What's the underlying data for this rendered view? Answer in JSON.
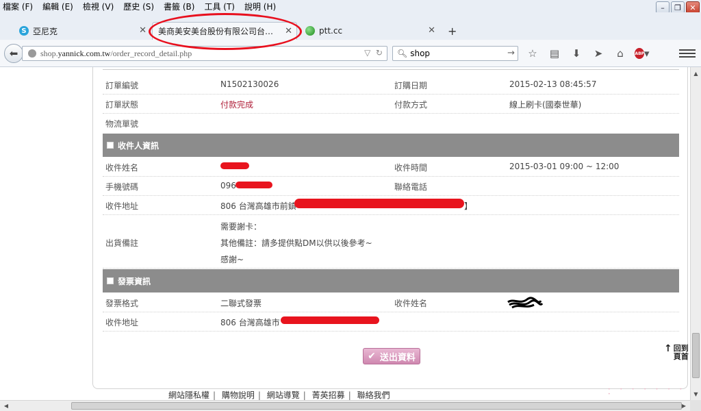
{
  "menu": [
    "檔案 (F)",
    "編輯 (E)",
    "檢視 (V)",
    "歷史 (S)",
    "書籤 (B)",
    "工具 (T)",
    "說明 (H)"
  ],
  "tabs": [
    {
      "label": "亞尼克",
      "icon_color": "#2aa4db",
      "icon": "S"
    },
    {
      "label": "美商美安美台股份有限公司台…",
      "active": true
    },
    {
      "label": "ptt.cc",
      "icon_color": "#2b9a2b"
    }
  ],
  "nav": {
    "url_prefix": "shop.",
    "url_host": "yannick.com.tw",
    "url_path": "/order_record_detail.php",
    "search_value": "shop"
  },
  "order": {
    "order_no_label": "訂單編號",
    "order_no": "N1502130026",
    "order_date_label": "訂購日期",
    "order_date": "2015-02-13 08:45:57",
    "status_label": "訂單狀態",
    "status": "付款完成",
    "payment_label": "付款方式",
    "payment": "線上刷卡(國泰世華)",
    "logistics_label": "物流單號"
  },
  "recipient": {
    "section_title": "收件人資訊",
    "name_label": "收件姓名",
    "time_label": "收件時間",
    "time": "2015-03-01 09:00 ~ 12:00",
    "mobile_label": "手機號碼",
    "mobile_prefix": "096",
    "phone_label": "聯絡電話",
    "address_label": "收件地址",
    "address_prefix": "806 台灣高雄市前鎮",
    "address_suffix": "】",
    "note_label": "出貨備註",
    "note_line1": "需要謝卡：",
    "note_line2": "其他備註：請多提供點DM以供以後參考~",
    "note_line3": "感謝~"
  },
  "invoice": {
    "section_title": "發票資訊",
    "format_label": "發票格式",
    "format": "二聯式發票",
    "name_label": "收件姓名",
    "address_label": "收件地址",
    "address_prefix": "806 台灣高雄市"
  },
  "actions": {
    "submit_label": "送出資料",
    "back_to_top_line1": "回到",
    "back_to_top_line2": "頁首"
  },
  "footer": [
    "網站隱私權",
    "購物說明",
    "網站導覽",
    "菁英招募",
    "聯絡我們"
  ],
  "colors": {
    "section_bg": "#8c8c8c",
    "status_red": "#b0203a",
    "annotation_red": "#e8101e",
    "submit_pink": "#cf88b0"
  }
}
